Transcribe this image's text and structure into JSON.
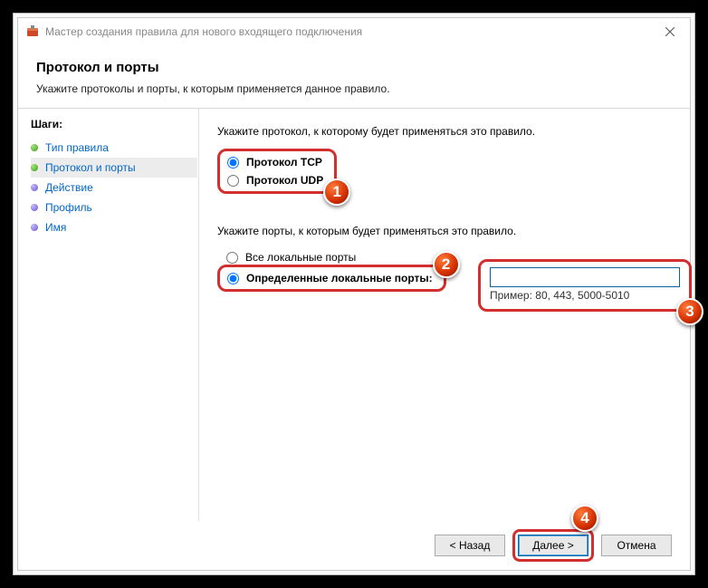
{
  "window": {
    "title": "Мастер создания правила для нового входящего подключения"
  },
  "header": {
    "title": "Протокол и порты",
    "subtitle": "Укажите протоколы и порты, к которым применяется данное правило."
  },
  "sidebar": {
    "steps_label": "Шаги:",
    "items": [
      {
        "label": "Тип правила"
      },
      {
        "label": "Протокол и порты"
      },
      {
        "label": "Действие"
      },
      {
        "label": "Профиль"
      },
      {
        "label": "Имя"
      }
    ]
  },
  "content": {
    "protocol_prompt": "Укажите протокол, к которому будет применяться это правило.",
    "protocol_tcp": "Протокол TCP",
    "protocol_udp": "Протокол UDP",
    "ports_prompt": "Укажите порты, к которым будет применяться это правило.",
    "all_ports": "Все локальные порты",
    "specific_ports": "Определенные локальные порты:",
    "port_example": "Пример: 80, 443, 5000-5010"
  },
  "buttons": {
    "back": "< Назад",
    "next": "Далее >",
    "cancel": "Отмена"
  },
  "callouts": {
    "c1": "1",
    "c2": "2",
    "c3": "3",
    "c4": "4"
  }
}
